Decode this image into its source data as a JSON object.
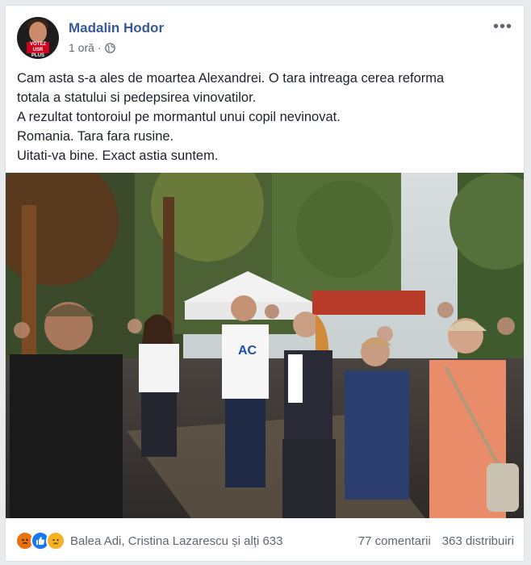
{
  "post": {
    "author": "Madalin Hodor",
    "time": "1 oră",
    "separator": "·",
    "avatar_badge": "VOTEZ USR PLUS",
    "text_lines": [
      "Cam asta s-a ales de moartea Alexandrei. O tara intreaga cerea reforma",
      "totala a statului si pedepsirea vinovatilor.",
      "A rezultat tontoroiul pe mormantul unui copil nevinovat.",
      "Romania. Tara fara rusine.",
      "Uitati-va bine. Exact astia suntem."
    ],
    "photo_shirt_text": "AC"
  },
  "footer": {
    "reacted_names": "Balea Adi, Cristina Lazarescu și alți 633",
    "comments": "77 comentarii",
    "shares": "363 distribuiri"
  },
  "icons": {
    "more": "more-options-icon",
    "audience": "globe-icon",
    "reactions": [
      "angry-reaction-icon",
      "like-reaction-icon",
      "sad-reaction-icon"
    ]
  },
  "colors": {
    "author_link": "#385898",
    "like": "#1877f2",
    "angry": "#e9710f",
    "sad": "#f7b125"
  }
}
